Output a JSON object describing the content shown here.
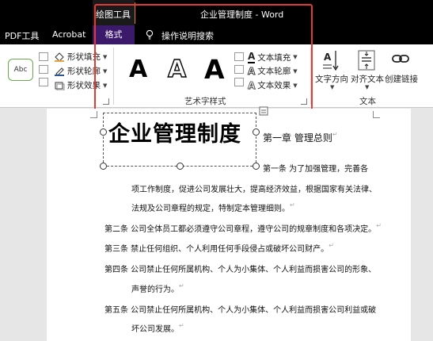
{
  "window": {
    "context_tab_group": "绘图工具",
    "doc_title": "企业管理制度  -  Word"
  },
  "tabs": {
    "pdf": "PDF工具",
    "acrobat": "Acrobat",
    "format": "格式",
    "tell_me": "操作说明搜索"
  },
  "ribbon": {
    "shape_style_sample": "Abc",
    "shape_fill": "形状填充",
    "shape_outline": "形状轮廓",
    "shape_effects": "形状效果",
    "wordart_letter": "A",
    "text_fill": "文本填充",
    "text_outline": "文本轮廓",
    "text_effects": "文本效果",
    "wordart_group_label": "艺术字样式",
    "text_direction": "文字方向",
    "align_text": "对齐文本",
    "create_link": "创建链接",
    "text_group_label": "文本"
  },
  "document": {
    "wordart_title": "企业管理制度",
    "chapter_heading": "第一章  管理总则",
    "lines": [
      "第一条    为了加强管理，完善各",
      "项工作制度，促进公司发展壮大，提高经济效益，根据国家有关法律、",
      "法规及公司章程的规定，特制定本管理细则。",
      "第二条  公司全体员工都必须遵守公司章程，遵守公司的规章制度和各项决定。",
      "第三条  禁止任何组织、个人利用任何手段侵占或破坏公司财产。",
      "第四条  公司禁止任何所属机构、个人为小集体、个人利益而损害公司的形象、",
      "声誉的行为。",
      "第五条  公司禁止任何所属机构、个人为小集体、个人利益而损害公司利益或破",
      "坏公司发展。"
    ],
    "para_mark": "↵"
  },
  "colors": {
    "highlight": "#e53935",
    "format_tab": "#3c1a6b",
    "context_separator": "#e87a1e"
  }
}
